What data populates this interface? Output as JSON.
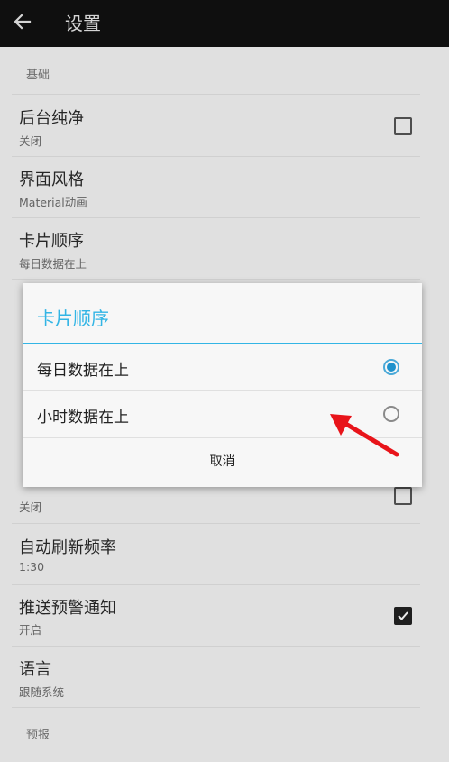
{
  "toolbar": {
    "title": "设置"
  },
  "sections": {
    "basic": "基础",
    "forecast": "预报"
  },
  "prefs": [
    {
      "title": "后台纯净",
      "summary": "关闭",
      "checkbox": false
    },
    {
      "title": "界面风格",
      "summary": "Material动画"
    },
    {
      "title": "卡片顺序",
      "summary": "每日数据在上"
    },
    {
      "title": "",
      "summary": "关闭",
      "checkbox": false
    },
    {
      "title": "自动刷新频率",
      "summary": "1:30"
    },
    {
      "title": "推送预警通知",
      "summary": "开启",
      "checkbox": true
    },
    {
      "title": "语言",
      "summary": "跟随系统"
    }
  ],
  "dialog": {
    "title": "卡片顺序",
    "options": [
      {
        "label": "每日数据在上",
        "selected": true
      },
      {
        "label": "小时数据在上",
        "selected": false
      }
    ],
    "cancel_label": "取消"
  },
  "colors": {
    "accent": "#33b5e5",
    "toolbar": "#111111",
    "annotation_arrow": "#e8141a"
  }
}
